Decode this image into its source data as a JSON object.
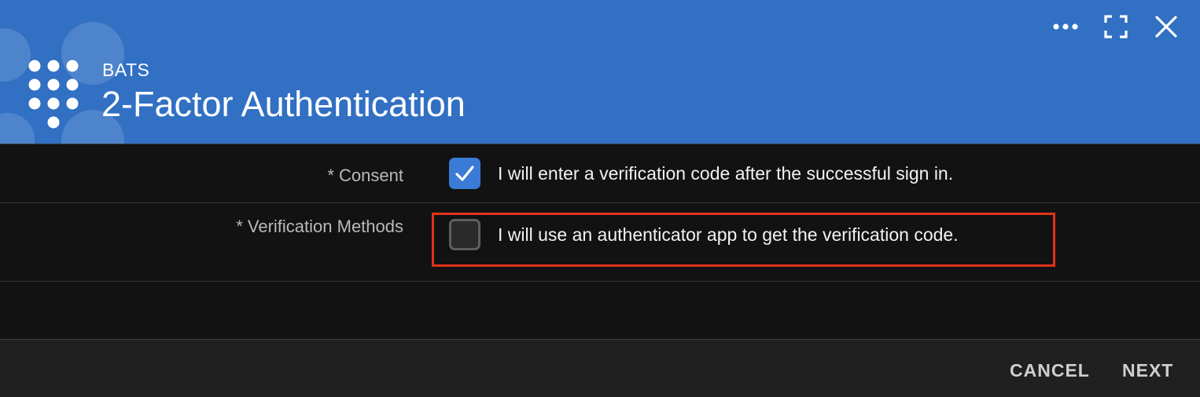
{
  "header": {
    "app_name": "BATS",
    "title": "2-Factor Authentication",
    "color": "#3170c3",
    "icons": [
      "more-options-icon",
      "expand-icon",
      "close-icon"
    ]
  },
  "form": {
    "consent": {
      "label": "* Consent",
      "option_text": "I will enter a verification code after the successful sign in.",
      "checked": true
    },
    "verification_methods": {
      "label": "* Verification Methods",
      "option_text": "I will use an authenticator app to get the verification code.",
      "checked": false,
      "highlighted": true,
      "highlight_color": "#e0321c"
    }
  },
  "footer": {
    "cancel_label": "CANCEL",
    "next_label": "NEXT"
  }
}
